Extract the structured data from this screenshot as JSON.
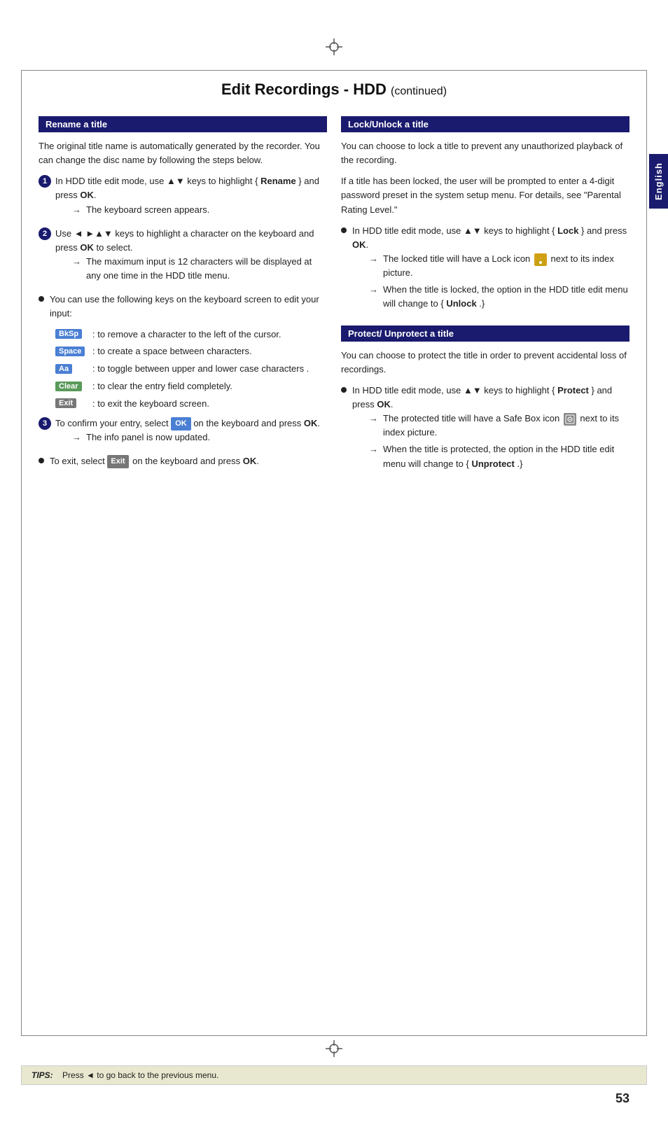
{
  "page": {
    "title": "Edit Recordings - HDD",
    "title_suffix": "(continued)",
    "page_number": "53"
  },
  "english_tab": "English",
  "tips": {
    "label": "TIPS:",
    "text": "Press ◄ to go back to the previous menu."
  },
  "left_section": {
    "header": "Rename a title",
    "intro": "The original title name is automatically generated by the recorder. You can change the disc name by following the steps below.",
    "steps": [
      {
        "num": "1",
        "text": "In HDD title edit mode, use ▲▼ keys to highlight { Rename } and press OK.",
        "arrow": "The keyboard screen appears."
      },
      {
        "num": "2",
        "text": "Use ◄ ►▲▼ keys to highlight a character on the keyboard and press OK to select.",
        "arrow": "The maximum input is 12 characters will be displayed at any one time in the HDD title menu."
      }
    ],
    "bullet": "You can use the following keys on the keyboard screen to edit your input:",
    "keys": [
      {
        "key": "BkSp",
        "desc": ": to remove a character to the left of the cursor."
      },
      {
        "key": "Space",
        "desc": ": to create a space between characters."
      },
      {
        "key": "Aa",
        "desc": ": to toggle between upper and lower case characters ."
      },
      {
        "key": "Clear",
        "desc": ": to clear the entry field completely."
      },
      {
        "key": "Exit",
        "desc": ": to exit the keyboard screen."
      }
    ],
    "step3": {
      "num": "3",
      "text": "To confirm your entry, select",
      "ok": "OK",
      "text2": "on the keyboard and press OK.",
      "arrow": "The info panel is now updated."
    },
    "step4": {
      "bullet": "To exit, select",
      "exit": "Exit",
      "text2": "on the keyboard and press OK."
    }
  },
  "right_section": {
    "lock_header": "Lock/Unlock a title",
    "lock_intro": "You can choose to lock a title to prevent any unauthorized playback of the recording.",
    "lock_body": "If a title has been locked, the user will be prompted to enter a 4-digit password preset in the system setup menu. For details, see \"Parental Rating Level.\"",
    "lock_bullet": {
      "text": "In HDD title edit mode, use ▲▼ keys to highlight { Lock } and press OK.",
      "arrow1": "The locked title will have a Lock icon",
      "arrow1b": "next to its index picture.",
      "arrow2": "When the title is locked, the option in the HDD title edit menu will change to { Unlock .}"
    },
    "protect_header": "Protect/ Unprotect a title",
    "protect_intro": "You can choose to protect the title in order to prevent accidental loss of recordings.",
    "protect_bullet": {
      "text": "In HDD title edit mode, use ▲▼ keys to highlight { Protect } and press OK.",
      "arrow1": "The protected title will have a Safe Box icon",
      "arrow1b": "next to its index picture.",
      "arrow2": "When the title is protected, the option in the HDD title edit menu will change to { Unprotect .}"
    }
  }
}
